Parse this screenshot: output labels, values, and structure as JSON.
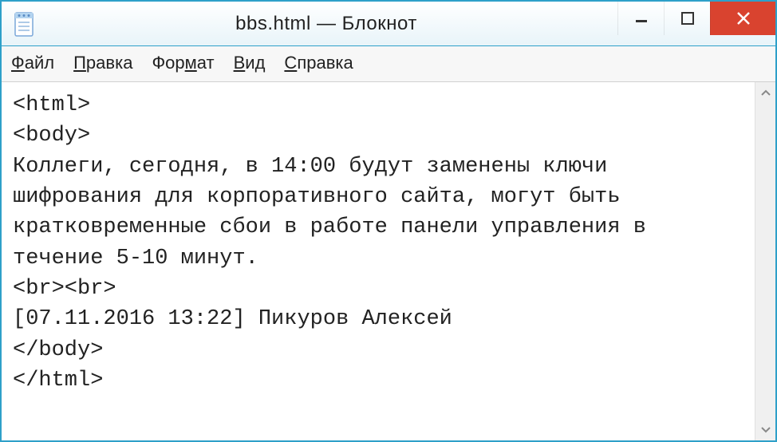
{
  "window": {
    "title": "bbs.html — Блокнот"
  },
  "menu": {
    "items": [
      {
        "letter": "Ф",
        "rest": "айл"
      },
      {
        "letter": "П",
        "rest": "равка"
      },
      {
        "letter": "",
        "rest": "Фор",
        "mid_letter": "м",
        "rest2": "ат"
      },
      {
        "letter": "В",
        "rest": "ид"
      },
      {
        "letter": "С",
        "rest": "правка"
      }
    ]
  },
  "editor": {
    "content": "<html>\n<body>\nКоллеги, сегодня, в 14:00 будут заменены ключи шифрования для корпоративного сайта, могут быть кратковременные сбои в работе панели управления в течение 5-10 минут.\n<br><br>\n[07.11.2016 13:22] Пикуров Алексей\n</body>\n</html>"
  }
}
